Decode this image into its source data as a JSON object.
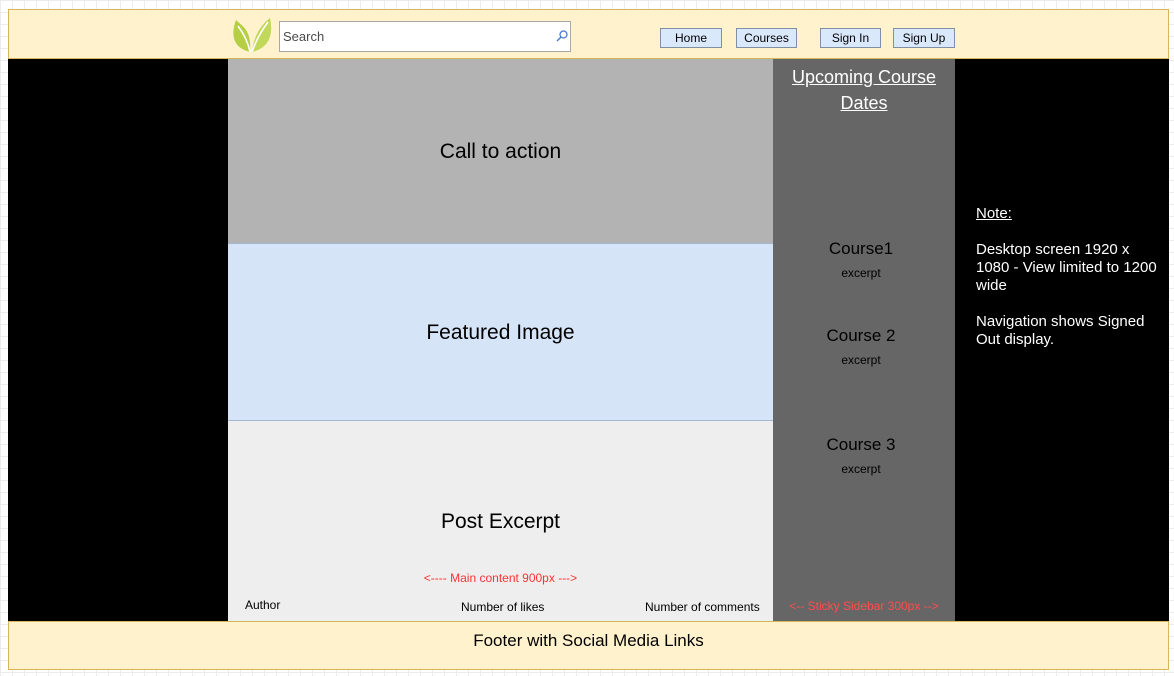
{
  "header": {
    "search_placeholder": "Search",
    "nav": {
      "home": "Home",
      "courses": "Courses",
      "sign_in": "Sign In",
      "sign_up": "Sign Up"
    }
  },
  "main": {
    "call_to_action": "Call to action",
    "featured_image": "Featured Image",
    "post_excerpt": "Post Excerpt",
    "width_annotation": "<----  Main content 900px  --->",
    "author": "Author",
    "likes": "Number of likes",
    "comments": "Number of comments"
  },
  "sidebar": {
    "heading_line1": "Upcoming Course",
    "heading_line2": "Dates",
    "courses": [
      {
        "title": "Course1",
        "excerpt": "excerpt"
      },
      {
        "title": "Course 2",
        "excerpt": "excerpt"
      },
      {
        "title": "Course 3",
        "excerpt": "excerpt"
      }
    ],
    "width_annotation": "<--  Sticky Sidebar 300px  -->"
  },
  "note": {
    "title": "Note:",
    "line1": "Desktop screen 1920 x 1080 - View limited to 1200 wide",
    "line2": "Navigation shows Signed Out display."
  },
  "footer": {
    "text": "Footer with Social Media Links"
  },
  "colors": {
    "header_bg": "#fff2cc",
    "annotation_red": "#ff3333",
    "logo_green": "#b5cf45",
    "featured_bg": "#d6e4f8",
    "sidebar_bg": "#666666"
  }
}
